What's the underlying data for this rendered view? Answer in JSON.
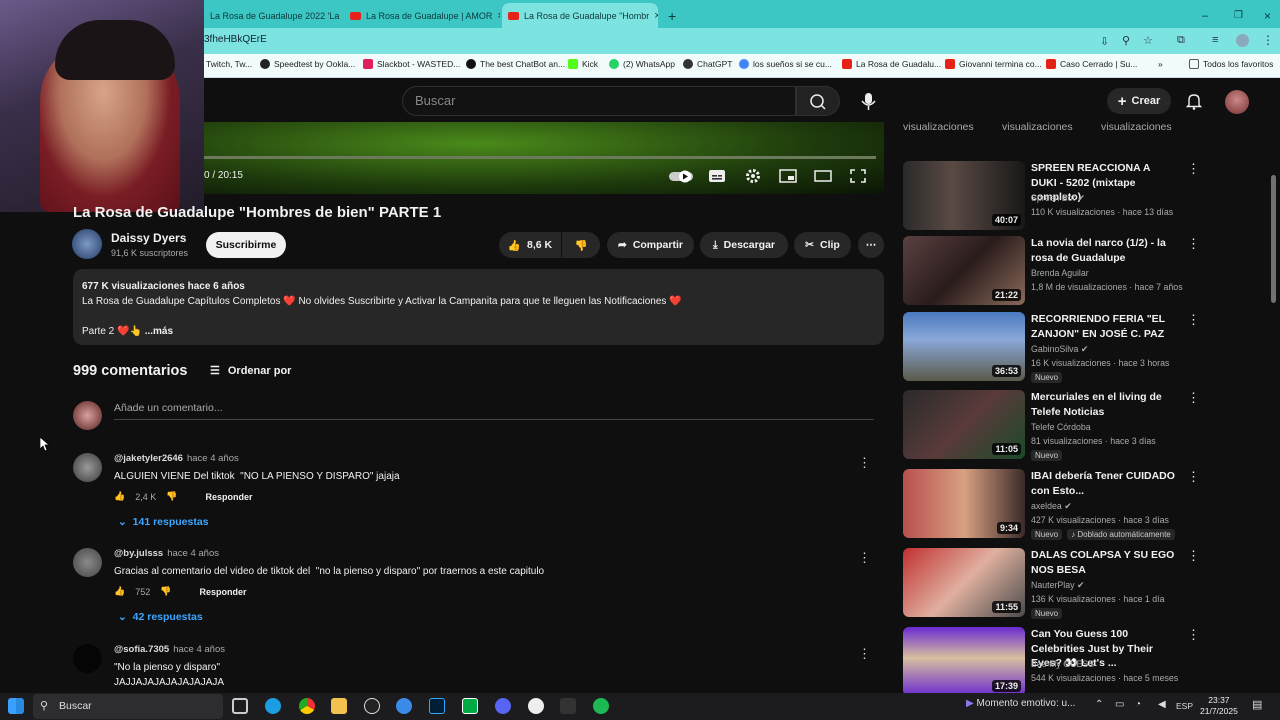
{
  "browser": {
    "tabs": [
      {
        "label": "La Rosa de Guadalupe 2022 'La"
      },
      {
        "label": "La Rosa de Guadalupe | AMOR"
      },
      {
        "label": "La Rosa de Guadalupe \"Hombr"
      }
    ],
    "url": "3fheHBkQErE",
    "bookmarks": [
      "Twitch, Tw...",
      "Speedtest by Ookla...",
      "Slackbot - WASTED...",
      "The best ChatBot an...",
      "Kick",
      "(2) WhatsApp",
      "ChatGPT",
      "los sueños si se cu...",
      "La Rosa de Guadalu...",
      "Giovanni termina co...",
      "Caso Cerrado | Su...",
      "Todos los favoritos"
    ]
  },
  "header": {
    "search_placeholder": "Buscar",
    "create_label": "Crear"
  },
  "player": {
    "time": "0 / 20:15"
  },
  "video": {
    "title": "La Rosa de Guadalupe \"Hombres de bien\" PARTE 1",
    "channel": "Daissy Dyers",
    "subscribers": "91,6 K suscriptores",
    "subscribe_label": "Suscribirme",
    "likes": "8,6 K",
    "share": "Compartir",
    "download": "Descargar",
    "clip": "Clip"
  },
  "description": {
    "stats": "677 K visualizaciones  hace 6 años",
    "line1": "La Rosa de Guadalupe  Capítulos Completos ❤️ No olvides Suscribirte y Activar la Campanita para que te lleguen las  Notificaciones ❤️",
    "line2": "Parte 2 ❤️👆",
    "more": " ...más"
  },
  "comments": {
    "count": "999 comentarios",
    "sort": "Ordenar por",
    "add_placeholder": "Añade un comentario...",
    "reply_label": "Responder",
    "items": [
      {
        "user": "@jaketyler2646",
        "age": "hace 4 años",
        "text": "ALGUIEN VIENE Del tiktok  \"NO LA PIENSO Y DISPARO\" jajaja",
        "likes": "2,4 K",
        "replies": "141 respuestas"
      },
      {
        "user": "@by.julsss",
        "age": "hace 4 años",
        "text": "Gracias al comentario del video de tiktok del  \"no la pienso y disparo\" por traernos a este capitulo",
        "likes": "752",
        "replies": "42 respuestas"
      },
      {
        "user": "@sofia.7305",
        "age": "hace 4 años",
        "text": "\"No la pienso y disparo\"\nJAJJAJAJAJAJAJAJAJA",
        "likes": "",
        "replies": ""
      }
    ]
  },
  "sidebar": {
    "views_header": "visualizaciones",
    "items": [
      {
        "title": "SPREEN REACCIONA A DUKI - 5202 (mixtape completo)",
        "channel": "Spreen Bot",
        "meta": "110 K visualizaciones · hace 13 días",
        "duration": "40:07",
        "badges": []
      },
      {
        "title": "La novia del narco (1/2) - la rosa de Guadalupe",
        "channel": "Brenda Aguilar",
        "meta": "1,8 M de visualizaciones · hace 7 años",
        "duration": "21:22",
        "badges": []
      },
      {
        "title": "RECORRIENDO FERIA \"EL ZANJON\" EN JOSÉ C. PAZ",
        "channel": "GabinoSilva",
        "meta": "16 K visualizaciones · hace 3 horas",
        "duration": "36:53",
        "badges": [
          "Nuevo"
        ]
      },
      {
        "title": "Mercuriales en el living de Telefe Noticias",
        "channel": "Telefe Córdoba",
        "meta": "81 visualizaciones · hace 3 días",
        "duration": "11:05",
        "badges": [
          "Nuevo"
        ]
      },
      {
        "title": "IBAI debería Tener CUIDADO con Esto...",
        "channel": "axeldea",
        "meta": "427 K visualizaciones · hace 3 días",
        "duration": "9:34",
        "badges": [
          "Nuevo",
          "Doblado automáticamente"
        ]
      },
      {
        "title": "DALAS COLAPSA Y SU EGO NOS BESA",
        "channel": "NauterPlay",
        "meta": "136 K visualizaciones · hace 1 día",
        "duration": "11:55",
        "badges": [
          "Nuevo"
        ]
      },
      {
        "title": "Can You Guess 100 Celebrities Just by Their Eyes? 👀 Let's ...",
        "channel": "Bee My GUESS",
        "meta": "544 K visualizaciones · hace 5 meses",
        "duration": "17:39",
        "badges": []
      }
    ]
  },
  "taskbar": {
    "search": "Buscar",
    "media": "Momento emotivo: u...",
    "lang": "ESP",
    "time": "23:37",
    "date": "21/7/2025"
  }
}
